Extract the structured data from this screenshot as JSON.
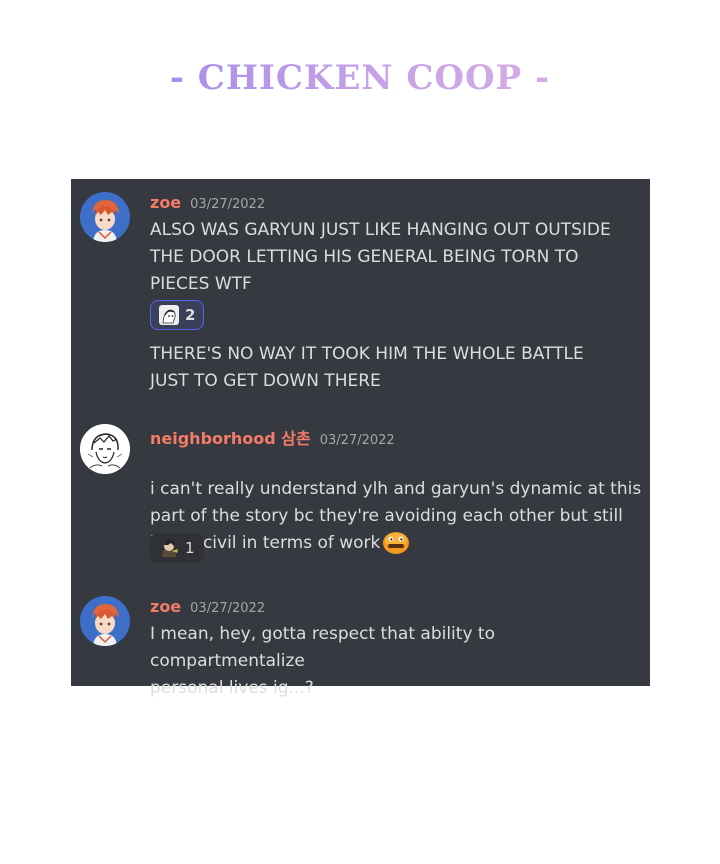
{
  "page": {
    "title": "- CHICKEN COOP -"
  },
  "colors": {
    "chat_background": "#36393f",
    "username": "#f47b67",
    "message_text": "#dcddde",
    "timestamp": "#a3a6aa",
    "reaction_active_border": "#5865f2"
  },
  "messages": [
    {
      "author": "zoe",
      "avatar_icon": "anime-avatar-red-hair",
      "timestamp": "03/27/2022",
      "lines": [
        "ALSO WAS GARYUN JUST LIKE HANGING OUT OUTSIDE\nTHE DOOR LETTING HIS GENERAL BEING TORN TO\nPIECES WTF"
      ],
      "reaction": {
        "emoji": "sketch-character-emoji",
        "count": "2",
        "reacted": true
      },
      "followup": "THERE'S NO WAY IT TOOK HIM THE WHOLE BATTLE\nJUST TO GET DOWN THERE"
    },
    {
      "author": "neighborhood 삼촌",
      "avatar_icon": "sketch-avatar",
      "timestamp": "03/27/2022",
      "text": "i can't really understand ylh and garyun's dynamic at this\npart of the story bc they're avoiding each other but still\nbeing civil in terms of work",
      "inline_emoji": "orange-blob-emoji",
      "reaction": {
        "emoji": "character-emoji",
        "count": "1",
        "reacted": false
      }
    },
    {
      "author": "zoe",
      "avatar_icon": "anime-avatar-red-hair",
      "timestamp": "03/27/2022",
      "text": "I mean, hey, gotta respect that ability to compartmentalize\npersonal lives ig...?"
    }
  ]
}
